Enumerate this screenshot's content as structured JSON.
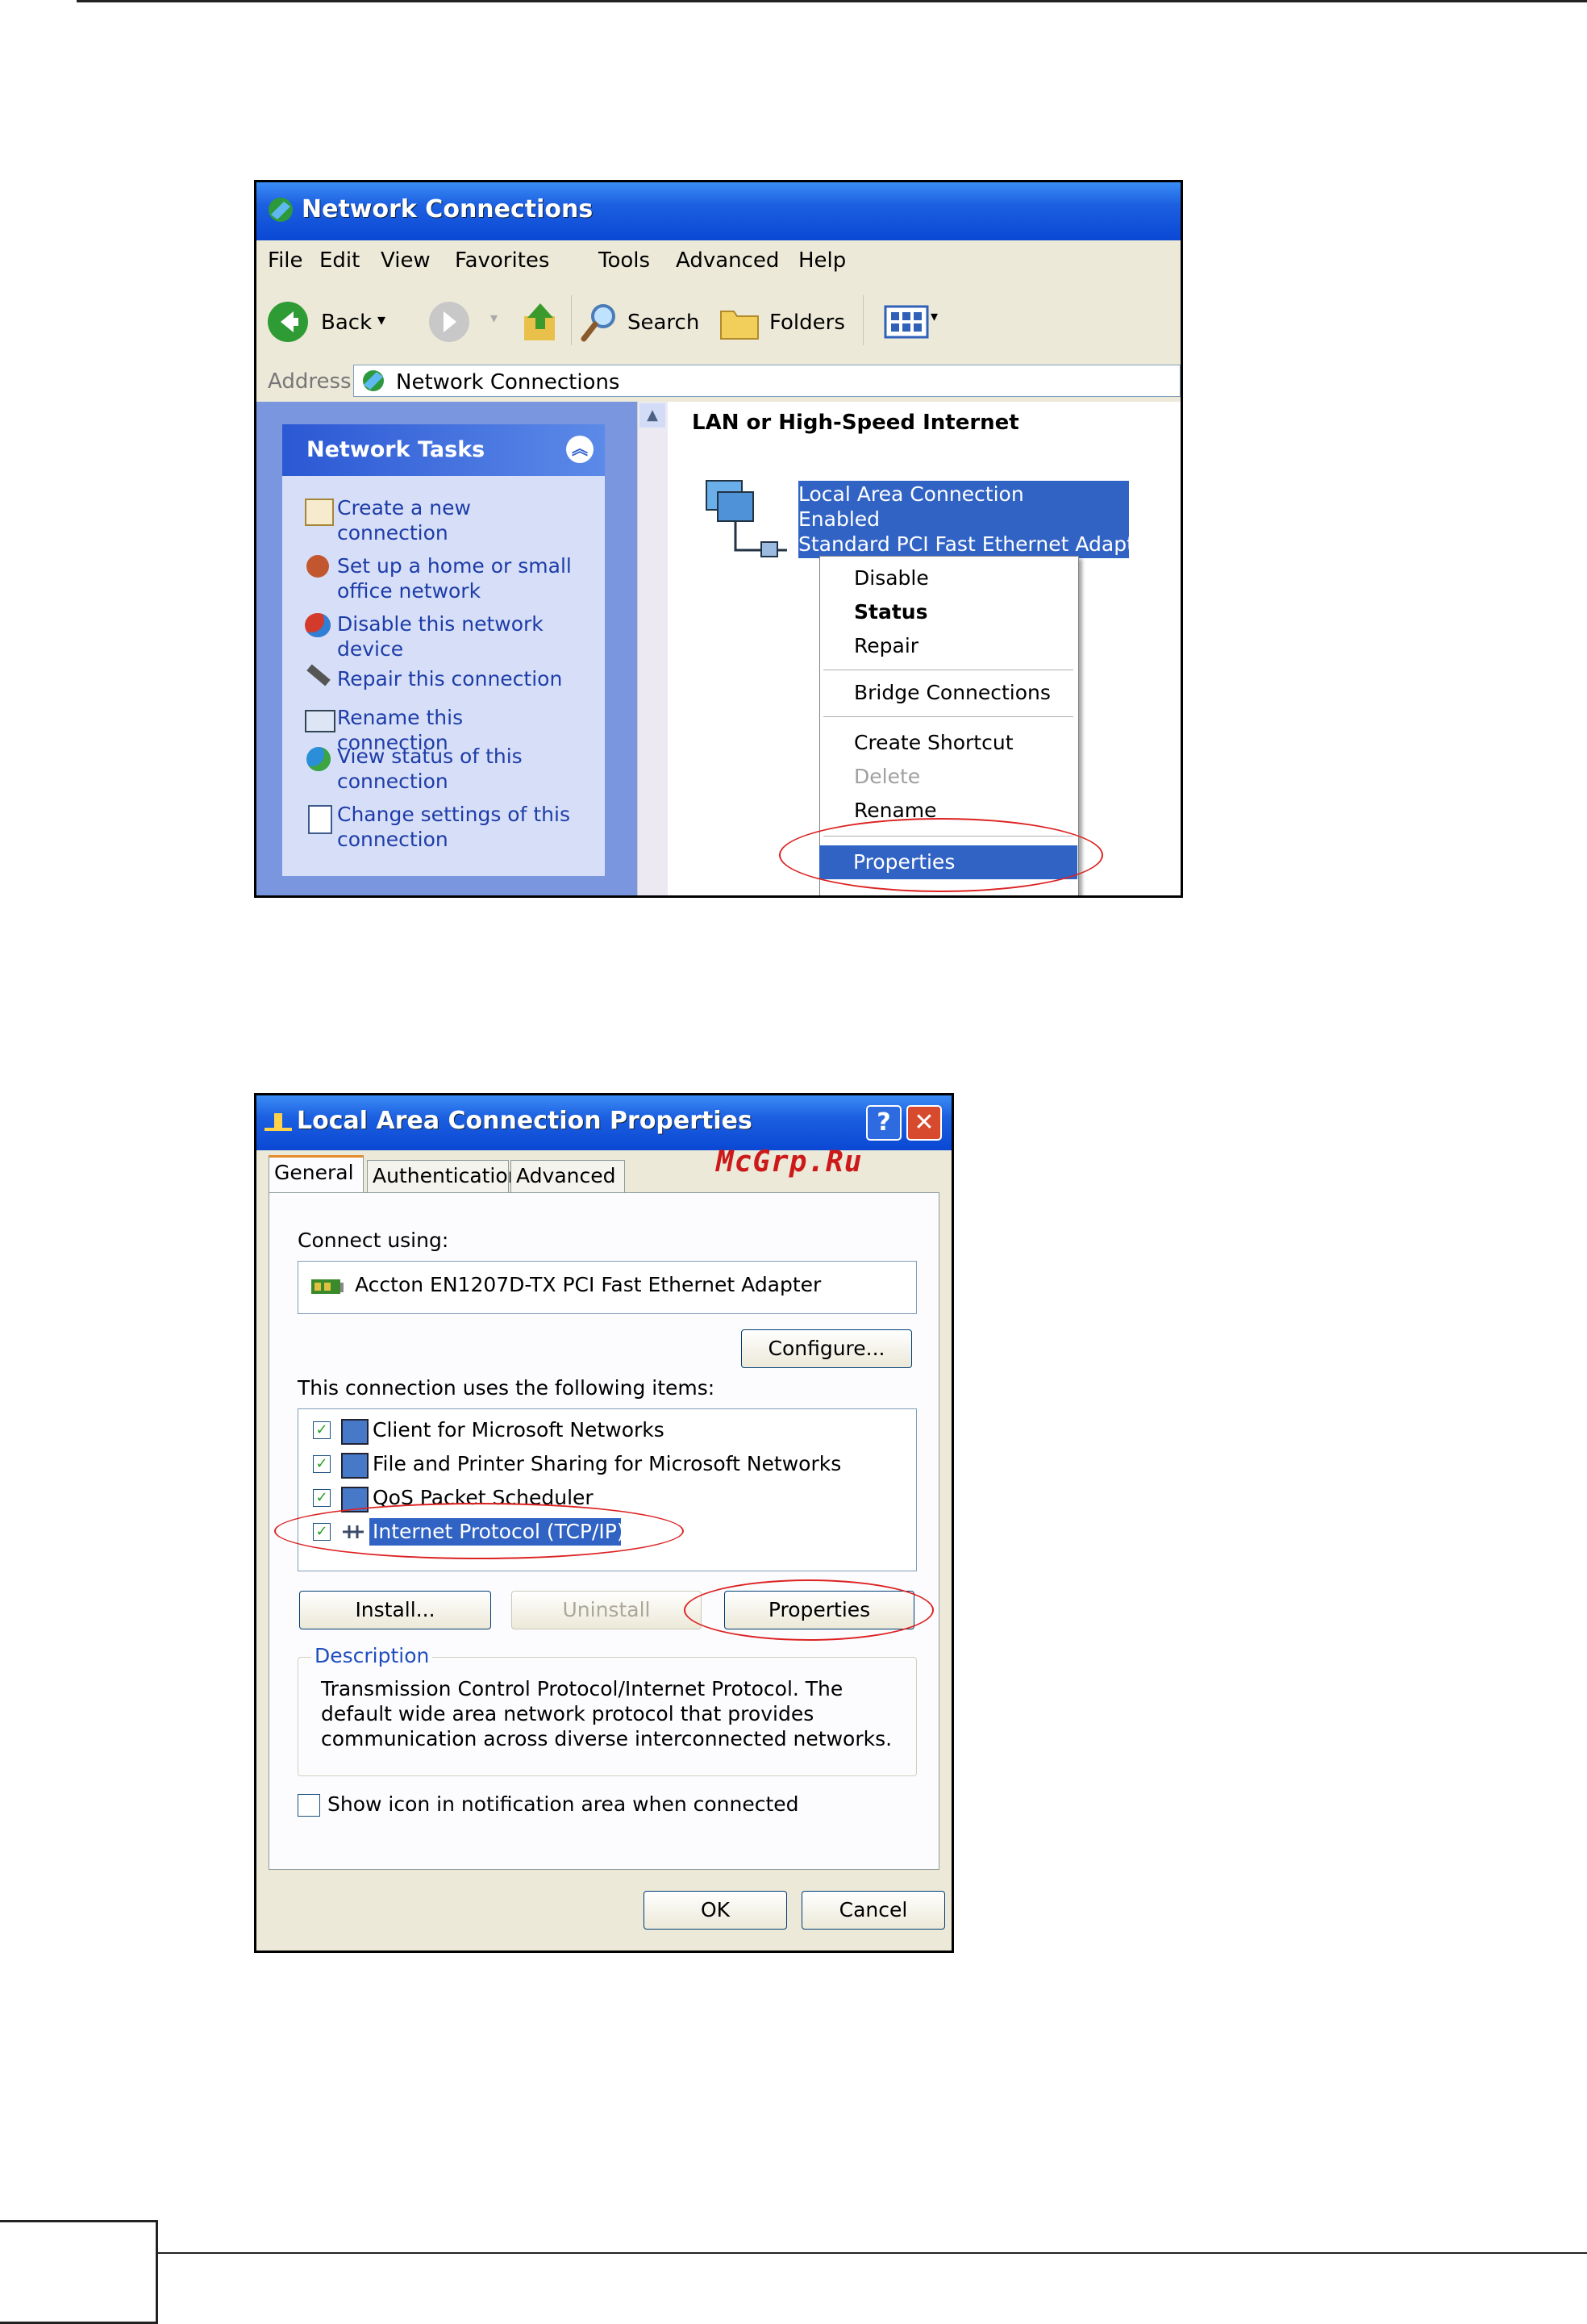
{
  "network_connections": {
    "title": "Network Connections",
    "menu": [
      "File",
      "Edit",
      "View",
      "Favorites",
      "Tools",
      "Advanced",
      "Help"
    ],
    "toolbar": {
      "back": "Back",
      "search": "Search",
      "folders": "Folders"
    },
    "address": {
      "label": "Address",
      "value": "Network Connections"
    },
    "tasks": {
      "header": "Network Tasks",
      "items": [
        "Create a new connection",
        "Set up a home or small office network",
        "Disable this network device",
        "Repair this connection",
        "Rename this connection",
        "View status of this connection",
        "Change settings of this connection"
      ]
    },
    "section_header": "LAN or High-Speed Internet",
    "connection": {
      "name": "Local Area Connection",
      "status": "Enabled",
      "device": "Standard PCI Fast Ethernet Adapter"
    },
    "context_menu": {
      "disable": "Disable",
      "status": "Status",
      "repair": "Repair",
      "bridge": "Bridge Connections",
      "shortcut": "Create Shortcut",
      "delete": "Delete",
      "rename": "Rename",
      "properties": "Properties"
    }
  },
  "lac_properties": {
    "title": "Local Area Connection Properties",
    "help_btn": "?",
    "close_btn": "✕",
    "tabs": [
      "General",
      "Authentication",
      "Advanced"
    ],
    "connect_using_label": "Connect using:",
    "adapter": "Accton EN1207D-TX PCI Fast Ethernet Adapter",
    "configure_btn": "Configure...",
    "items_label": "This connection uses the following items:",
    "items": [
      "Client for Microsoft Networks",
      "File and Printer Sharing for Microsoft Networks",
      "QoS Packet Scheduler",
      "Internet Protocol (TCP/IP)"
    ],
    "install_btn": "Install...",
    "uninstall_btn": "Uninstall",
    "properties_btn": "Properties",
    "description_label": "Description",
    "description": "Transmission Control Protocol/Internet Protocol. The default wide area network protocol that provides communication across diverse interconnected networks.",
    "show_icon_label": "Show icon in notification area when connected",
    "ok_btn": "OK",
    "cancel_btn": "Cancel"
  },
  "watermark": "McGrp.Ru"
}
